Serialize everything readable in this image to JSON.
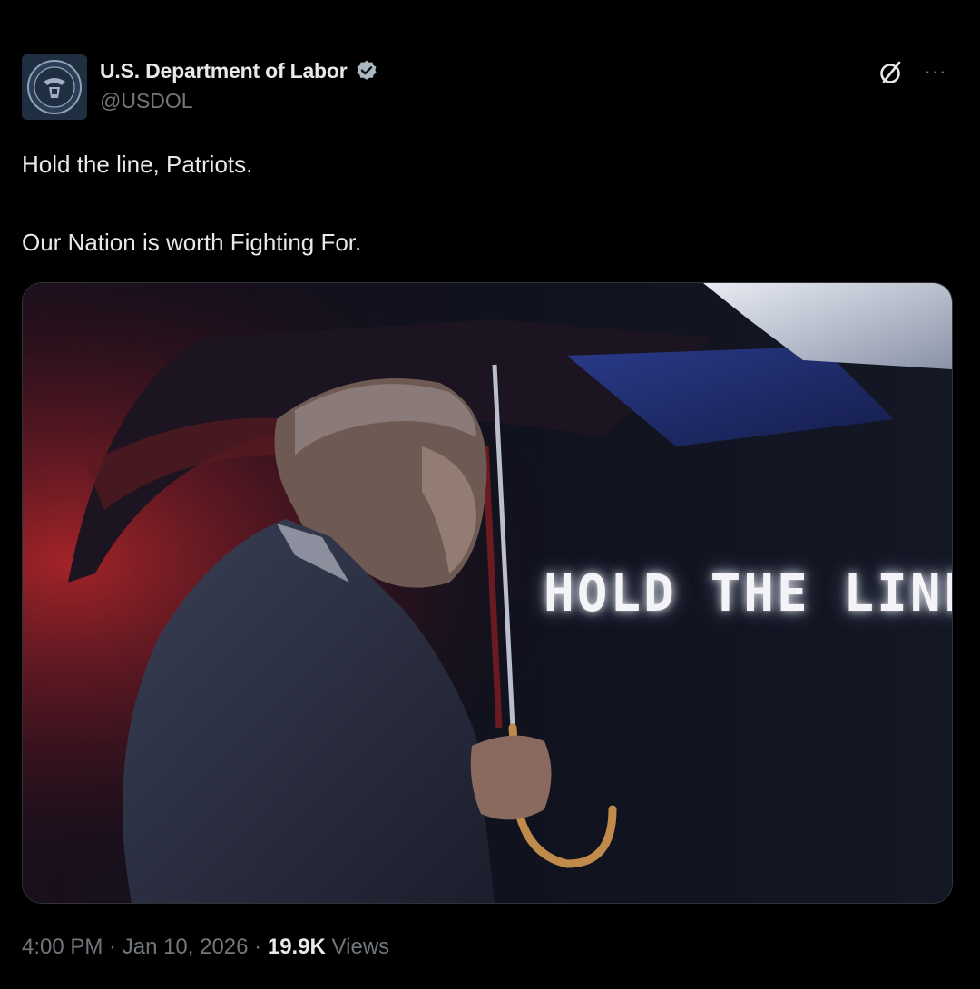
{
  "account": {
    "display_name": "U.S. Department of Labor",
    "handle": "@USDOL",
    "avatar_icon": "department-of-labor-seal",
    "verified_icon": "verified-badge-icon",
    "verified_color": "#1d9bf0"
  },
  "header_actions": {
    "grok_icon": "grok-icon",
    "more_icon": "more-options-icon"
  },
  "tweet": {
    "line_1": "Hold the line, Patriots.",
    "line_2": "Our Nation is worth Fighting For."
  },
  "media": {
    "caption": "HOLD THE LINE."
  },
  "meta": {
    "time": "4:00 PM",
    "separator_1": " · ",
    "date": "Jan 10, 2026",
    "separator_2": " · ",
    "views_count": "19.9K",
    "views_label": " Views"
  },
  "colors": {
    "background": "#000000",
    "primary_text": "#e7e9ea",
    "secondary_text": "#71767b"
  }
}
